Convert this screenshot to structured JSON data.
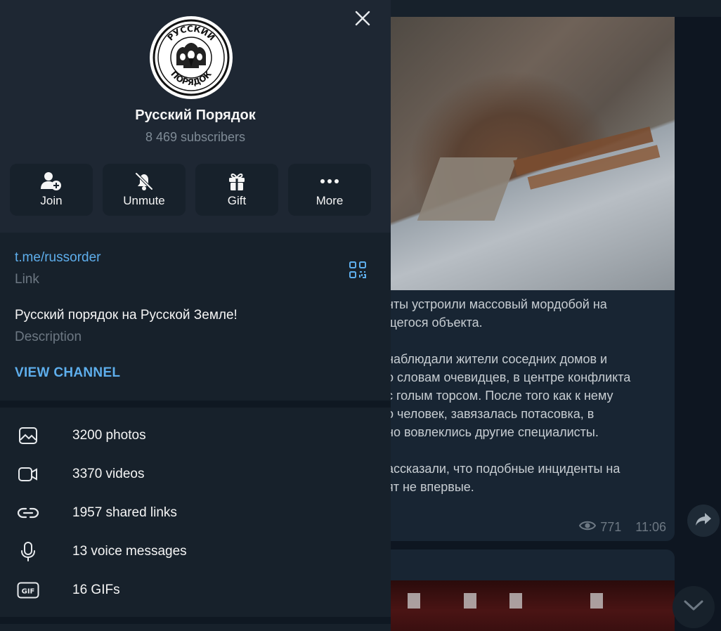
{
  "chat": {
    "message_lines": [
      "нты устроили массовый мордобой на",
      "щегося объекта.",
      "",
      "наблюдали жители соседних домов и",
      "о словам очевидцев, в центре конфликта",
      "с голым торсом. После того как к нему",
      "о человек, завязалась потасовка, в",
      "но вовлеклись другие специалисты.",
      "",
      "ассказали, что подобные инциденты на",
      "ят не впервые."
    ],
    "views": "771",
    "time": "11:06"
  },
  "channel": {
    "name": "Русский Порядок",
    "subscribers": "8 469 subscribers",
    "logo_top_text": "РУССКИЙ",
    "logo_bottom_text": "ПОРЯДОК"
  },
  "actions": [
    {
      "label": "Join",
      "icon": "add-user-icon"
    },
    {
      "label": "Unmute",
      "icon": "bell-off-icon"
    },
    {
      "label": "Gift",
      "icon": "gift-icon"
    },
    {
      "label": "More",
      "icon": "more-dots-icon"
    }
  ],
  "info": {
    "link": "t.me/russorder",
    "link_label": "Link",
    "description": "Русский порядок на Русской Земле!",
    "description_label": "Description",
    "view_channel": "VIEW CHANNEL"
  },
  "media": [
    {
      "label": "3200 photos",
      "icon": "photo-icon"
    },
    {
      "label": "3370 videos",
      "icon": "video-icon"
    },
    {
      "label": "1957 shared links",
      "icon": "link-icon"
    },
    {
      "label": "13 voice messages",
      "icon": "microphone-icon"
    },
    {
      "label": "16 GIFs",
      "icon": "gif-icon"
    }
  ],
  "colors": {
    "accent": "#5eaeec",
    "panel_bg": "#17212b",
    "header_bg": "#1e2733",
    "secondary_text": "#7f8b96"
  }
}
